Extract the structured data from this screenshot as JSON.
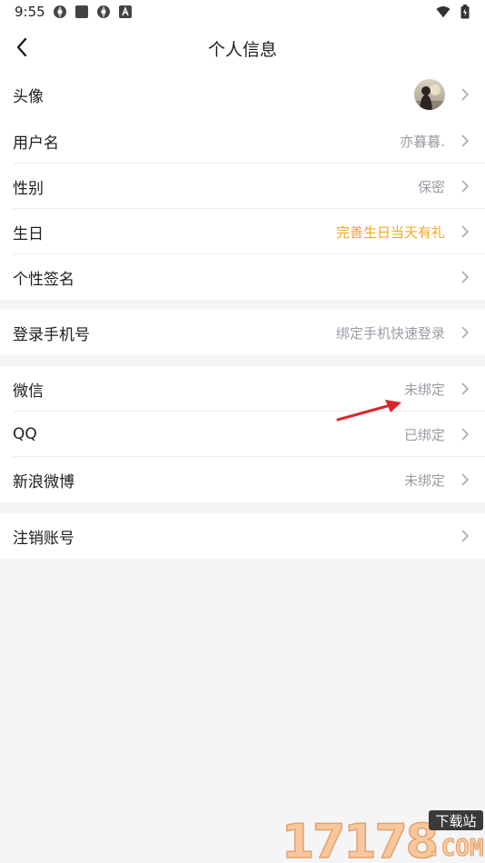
{
  "status_bar": {
    "time": "9:55",
    "left_icons": [
      "aperture-icon",
      "square-icon",
      "aperture-icon",
      "a-badge-icon"
    ],
    "right_icons": [
      "wifi-icon",
      "battery-icon"
    ]
  },
  "header": {
    "title": "个人信息",
    "back_icon": "chevron-left-icon"
  },
  "profile_section": [
    {
      "label": "头像",
      "value": "",
      "type": "avatar"
    },
    {
      "label": "用户名",
      "value": "亦暮暮."
    },
    {
      "label": "性别",
      "value": "保密"
    },
    {
      "label": "生日",
      "value": "完善生日当天有礼",
      "accent": "#f5a623"
    },
    {
      "label": "个性签名",
      "value": ""
    }
  ],
  "phone_section": [
    {
      "label": "登录手机号",
      "value": "绑定手机快速登录"
    }
  ],
  "social_section": [
    {
      "label": "微信",
      "value": "未绑定"
    },
    {
      "label": "QQ",
      "value": "已绑定"
    },
    {
      "label": "新浪微博",
      "value": "未绑定"
    }
  ],
  "account_section": [
    {
      "label": "注销账号",
      "value": ""
    }
  ],
  "watermark": {
    "number": "17178",
    "badge": "下载站",
    "domain": ".COM"
  },
  "colors": {
    "accent_orange": "#f5a623",
    "secondary_text": "#9a9ca3",
    "background": "#f5f5f7",
    "arrow_red": "#d9262c"
  }
}
